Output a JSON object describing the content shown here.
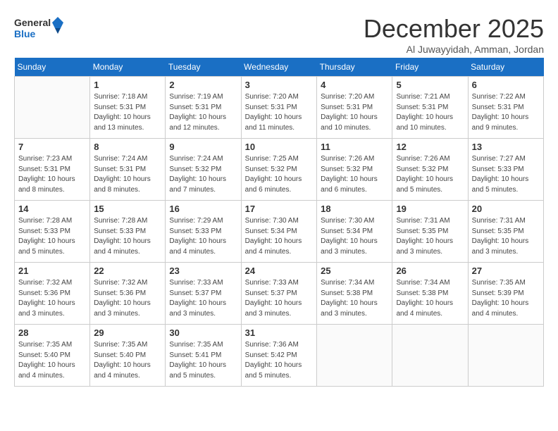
{
  "logo": {
    "line1": "General",
    "line2": "Blue"
  },
  "title": "December 2025",
  "location": "Al Juwayyidah, Amman, Jordan",
  "days_of_week": [
    "Sunday",
    "Monday",
    "Tuesday",
    "Wednesday",
    "Thursday",
    "Friday",
    "Saturday"
  ],
  "weeks": [
    [
      {
        "day": "",
        "info": ""
      },
      {
        "day": "1",
        "info": "Sunrise: 7:18 AM\nSunset: 5:31 PM\nDaylight: 10 hours\nand 13 minutes."
      },
      {
        "day": "2",
        "info": "Sunrise: 7:19 AM\nSunset: 5:31 PM\nDaylight: 10 hours\nand 12 minutes."
      },
      {
        "day": "3",
        "info": "Sunrise: 7:20 AM\nSunset: 5:31 PM\nDaylight: 10 hours\nand 11 minutes."
      },
      {
        "day": "4",
        "info": "Sunrise: 7:20 AM\nSunset: 5:31 PM\nDaylight: 10 hours\nand 10 minutes."
      },
      {
        "day": "5",
        "info": "Sunrise: 7:21 AM\nSunset: 5:31 PM\nDaylight: 10 hours\nand 10 minutes."
      },
      {
        "day": "6",
        "info": "Sunrise: 7:22 AM\nSunset: 5:31 PM\nDaylight: 10 hours\nand 9 minutes."
      }
    ],
    [
      {
        "day": "7",
        "info": "Sunrise: 7:23 AM\nSunset: 5:31 PM\nDaylight: 10 hours\nand 8 minutes."
      },
      {
        "day": "8",
        "info": "Sunrise: 7:24 AM\nSunset: 5:31 PM\nDaylight: 10 hours\nand 8 minutes."
      },
      {
        "day": "9",
        "info": "Sunrise: 7:24 AM\nSunset: 5:32 PM\nDaylight: 10 hours\nand 7 minutes."
      },
      {
        "day": "10",
        "info": "Sunrise: 7:25 AM\nSunset: 5:32 PM\nDaylight: 10 hours\nand 6 minutes."
      },
      {
        "day": "11",
        "info": "Sunrise: 7:26 AM\nSunset: 5:32 PM\nDaylight: 10 hours\nand 6 minutes."
      },
      {
        "day": "12",
        "info": "Sunrise: 7:26 AM\nSunset: 5:32 PM\nDaylight: 10 hours\nand 5 minutes."
      },
      {
        "day": "13",
        "info": "Sunrise: 7:27 AM\nSunset: 5:33 PM\nDaylight: 10 hours\nand 5 minutes."
      }
    ],
    [
      {
        "day": "14",
        "info": "Sunrise: 7:28 AM\nSunset: 5:33 PM\nDaylight: 10 hours\nand 5 minutes."
      },
      {
        "day": "15",
        "info": "Sunrise: 7:28 AM\nSunset: 5:33 PM\nDaylight: 10 hours\nand 4 minutes."
      },
      {
        "day": "16",
        "info": "Sunrise: 7:29 AM\nSunset: 5:33 PM\nDaylight: 10 hours\nand 4 minutes."
      },
      {
        "day": "17",
        "info": "Sunrise: 7:30 AM\nSunset: 5:34 PM\nDaylight: 10 hours\nand 4 minutes."
      },
      {
        "day": "18",
        "info": "Sunrise: 7:30 AM\nSunset: 5:34 PM\nDaylight: 10 hours\nand 3 minutes."
      },
      {
        "day": "19",
        "info": "Sunrise: 7:31 AM\nSunset: 5:35 PM\nDaylight: 10 hours\nand 3 minutes."
      },
      {
        "day": "20",
        "info": "Sunrise: 7:31 AM\nSunset: 5:35 PM\nDaylight: 10 hours\nand 3 minutes."
      }
    ],
    [
      {
        "day": "21",
        "info": "Sunrise: 7:32 AM\nSunset: 5:36 PM\nDaylight: 10 hours\nand 3 minutes."
      },
      {
        "day": "22",
        "info": "Sunrise: 7:32 AM\nSunset: 5:36 PM\nDaylight: 10 hours\nand 3 minutes."
      },
      {
        "day": "23",
        "info": "Sunrise: 7:33 AM\nSunset: 5:37 PM\nDaylight: 10 hours\nand 3 minutes."
      },
      {
        "day": "24",
        "info": "Sunrise: 7:33 AM\nSunset: 5:37 PM\nDaylight: 10 hours\nand 3 minutes."
      },
      {
        "day": "25",
        "info": "Sunrise: 7:34 AM\nSunset: 5:38 PM\nDaylight: 10 hours\nand 3 minutes."
      },
      {
        "day": "26",
        "info": "Sunrise: 7:34 AM\nSunset: 5:38 PM\nDaylight: 10 hours\nand 4 minutes."
      },
      {
        "day": "27",
        "info": "Sunrise: 7:35 AM\nSunset: 5:39 PM\nDaylight: 10 hours\nand 4 minutes."
      }
    ],
    [
      {
        "day": "28",
        "info": "Sunrise: 7:35 AM\nSunset: 5:40 PM\nDaylight: 10 hours\nand 4 minutes."
      },
      {
        "day": "29",
        "info": "Sunrise: 7:35 AM\nSunset: 5:40 PM\nDaylight: 10 hours\nand 4 minutes."
      },
      {
        "day": "30",
        "info": "Sunrise: 7:35 AM\nSunset: 5:41 PM\nDaylight: 10 hours\nand 5 minutes."
      },
      {
        "day": "31",
        "info": "Sunrise: 7:36 AM\nSunset: 5:42 PM\nDaylight: 10 hours\nand 5 minutes."
      },
      {
        "day": "",
        "info": ""
      },
      {
        "day": "",
        "info": ""
      },
      {
        "day": "",
        "info": ""
      }
    ]
  ]
}
